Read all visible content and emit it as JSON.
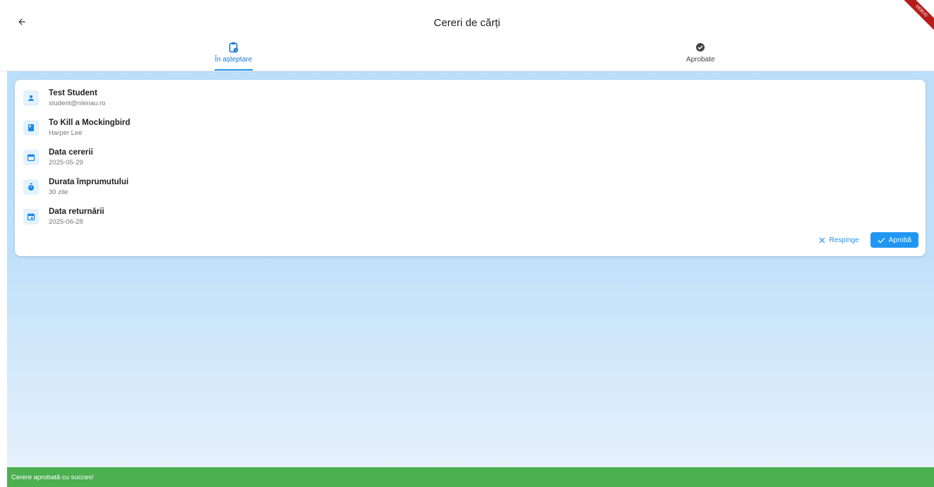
{
  "header": {
    "title": "Cereri de cărți",
    "debug_banner": "DEBUG"
  },
  "tabs": [
    {
      "label": "În așteptare",
      "icon": "pending-actions-icon",
      "active": true
    },
    {
      "label": "Aprobate",
      "icon": "check-circle-icon",
      "active": false
    }
  ],
  "request": {
    "student": {
      "name": "Test Student",
      "email": "student@nlenau.ro"
    },
    "book": {
      "title": "To Kill a Mockingbird",
      "author": "Harper Lee"
    },
    "request_date": {
      "label": "Data cererii",
      "value": "2025-05-29"
    },
    "duration": {
      "label": "Durata împrumutului",
      "value": "30 zile"
    },
    "return_date": {
      "label": "Data returnării",
      "value": "2025-06-28"
    },
    "actions": {
      "reject": "Respinge",
      "approve": "Aprobă"
    }
  },
  "snackbar": {
    "message": "Cerere aprobată cu succes!"
  },
  "colors": {
    "accent": "#2196f3",
    "success": "#4caf50",
    "background_top": "#bbdefb",
    "background_bottom": "#e6f1fb"
  }
}
